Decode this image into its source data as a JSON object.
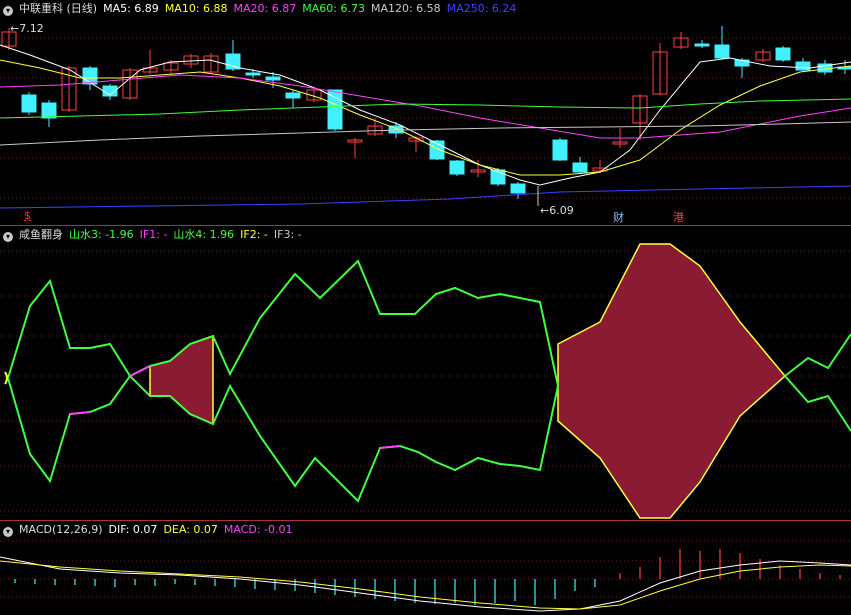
{
  "main": {
    "title": "中联重科 (日线)",
    "indicators": [
      {
        "text": "MA5: 6.89",
        "color": "#ffffff"
      },
      {
        "text": "MA10: 6.88",
        "color": "#ffff40"
      },
      {
        "text": "MA20: 6.87",
        "color": "#ff40ff"
      },
      {
        "text": "MA60: 6.73",
        "color": "#40ff40"
      },
      {
        "text": "MA120: 6.58",
        "color": "#c8c8c8"
      },
      {
        "text": "MA250: 6.24",
        "color": "#4040ff"
      }
    ],
    "high_label": "7.12",
    "low_label": "6.09",
    "markers": [
      {
        "text": "$",
        "color": "#ff3030"
      },
      {
        "text": "财",
        "color": "#80c0ff"
      },
      {
        "text": "港",
        "color": "#ff4040"
      }
    ]
  },
  "mid": {
    "title": "咸鱼翻身",
    "indicators": [
      {
        "text": "山水3: -1.96",
        "color": "#40ff40"
      },
      {
        "text": "IF1: -",
        "color": "#ff40ff"
      },
      {
        "text": "山水4: 1.96",
        "color": "#40ff40"
      },
      {
        "text": "IF2: -",
        "color": "#ffff40"
      },
      {
        "text": "IF3: -",
        "color": "#c8c8c8"
      }
    ]
  },
  "macd": {
    "title": "MACD(12,26,9)",
    "indicators": [
      {
        "text": "DIF: 0.07",
        "color": "#ffffff"
      },
      {
        "text": "DEA: 0.07",
        "color": "#ffff40"
      },
      {
        "text": "MACD: -0.01",
        "color": "#ff40ff"
      }
    ]
  },
  "colors": {
    "up": "#ff4040",
    "down": "#40f0ff",
    "fill": "#8b1a33"
  }
}
